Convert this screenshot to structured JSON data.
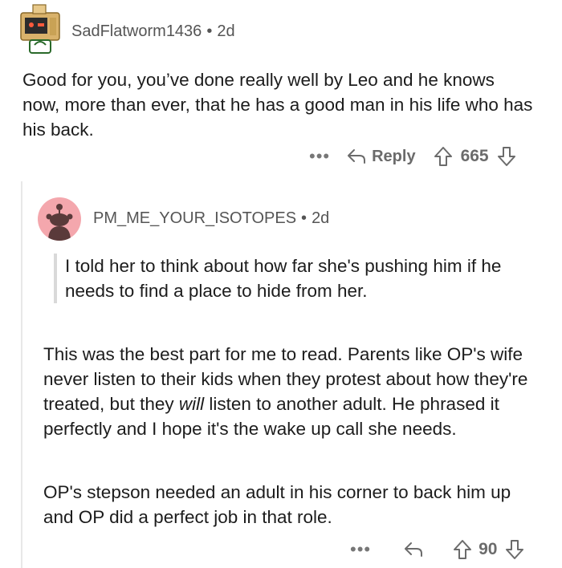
{
  "comment": {
    "author": "SadFlatworm1436",
    "separator": "•",
    "age": "2d",
    "body": "Good for you, you’ve done really well by Leo and he knows now, more than ever, that he has a good man in his life who has his back.",
    "more_label": "•••",
    "reply_label": "Reply",
    "score": "665"
  },
  "reply": {
    "author": "PM_ME_YOUR_ISOTOPES",
    "separator": "•",
    "age": "2d",
    "quote": "I told her to think about how far she's pushing him if he needs to find a place to hide from her.",
    "p1_before": "This was the best part for me to read.  Parents like OP's wife never listen to their kids when they protest about how they're treated, but they ",
    "p1_emph": "will",
    "p1_after": " listen to another adult.  He phrased it perfectly and I hope it's the wake up call she needs.",
    "p2": "OP's stepson needed an adult in his corner to back him up and OP did a perfect job in that role.",
    "more_label": "•••",
    "score": "90"
  },
  "colors": {
    "meta_gray": "#6b6b6b",
    "reply_avatar_bg": "#f4a7ad",
    "thread_line": "#e8e8e8"
  },
  "icons": [
    "robot-avatar",
    "snoo-avatar",
    "reply-arrow-icon",
    "upvote-icon",
    "downvote-icon"
  ]
}
